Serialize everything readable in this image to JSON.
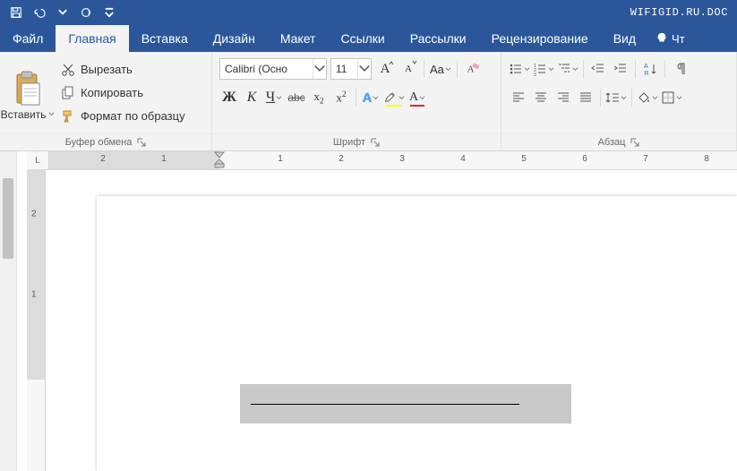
{
  "titlebar": {
    "document_name": "WIFIGID.RU.DOC"
  },
  "tabs": {
    "file": "Файл",
    "items": [
      "Главная",
      "Вставка",
      "Дизайн",
      "Макет",
      "Ссылки",
      "Рассылки",
      "Рецензирование",
      "Вид"
    ],
    "active_index": 0,
    "tell_me": "Чт"
  },
  "ribbon": {
    "clipboard": {
      "label": "Буфер обмена",
      "paste": "Вставить",
      "cut": "Вырезать",
      "copy": "Копировать",
      "format_painter": "Формат по образцу"
    },
    "font": {
      "label": "Шрифт",
      "name": "Calibri (Осно",
      "size": "11",
      "bold": "Ж",
      "italic": "К",
      "underline": "Ч",
      "strike": "abc",
      "sub": "x",
      "sup": "x",
      "effects": "A",
      "clear": "A",
      "grow": "A",
      "shrink": "A",
      "case": "Aa"
    },
    "paragraph": {
      "label": "Абзац"
    }
  },
  "ruler": {
    "corner": "L",
    "h_left_margin_numbers": [
      "2",
      "1"
    ],
    "h_numbers": [
      "1",
      "2",
      "3",
      "4",
      "5",
      "6",
      "7",
      "8"
    ],
    "v_numbers": [
      "2",
      "1"
    ]
  }
}
